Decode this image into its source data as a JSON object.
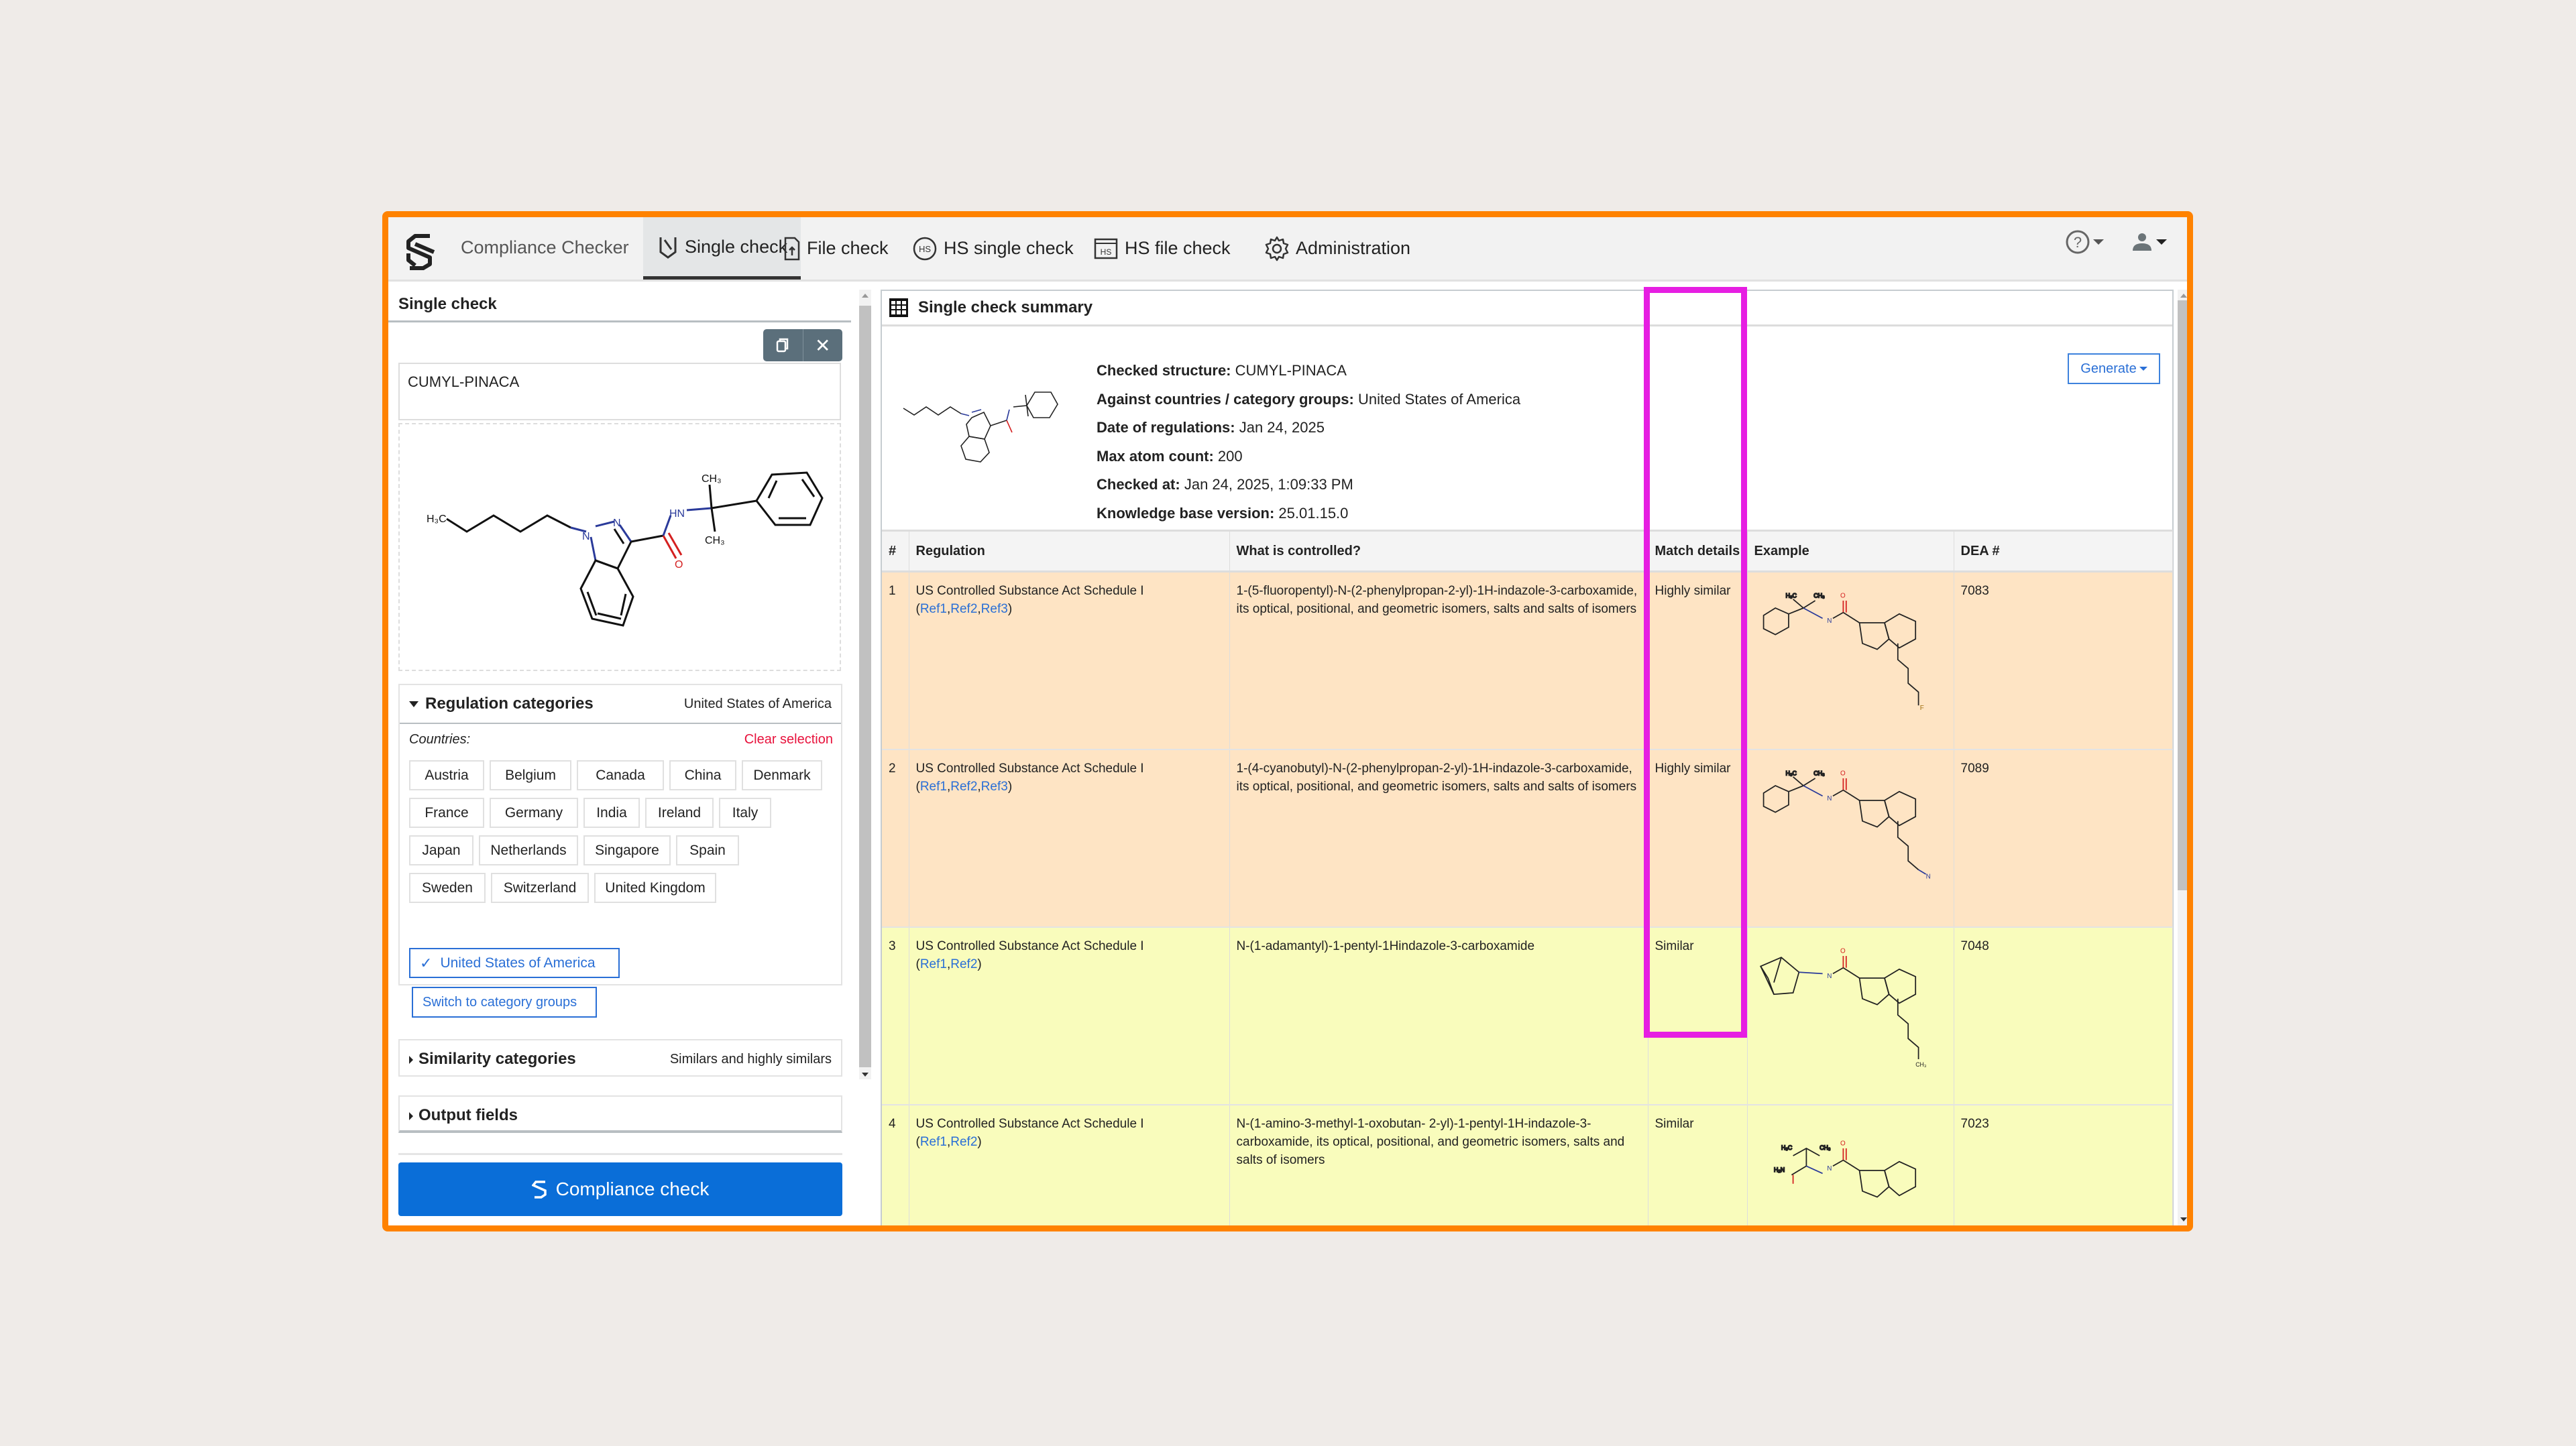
{
  "app": {
    "brand": "Compliance Checker",
    "nav": [
      {
        "label": "Single check",
        "icon": "single-check-icon",
        "active": true
      },
      {
        "label": "File check",
        "icon": "file-upload-icon",
        "active": false
      },
      {
        "label": "HS single check",
        "icon": "hs-globe-icon",
        "active": false
      },
      {
        "label": "HS file check",
        "icon": "hs-file-icon",
        "active": false
      },
      {
        "label": "Administration",
        "icon": "gear-icon",
        "active": false
      }
    ],
    "help_icon": "help-icon",
    "user_icon": "user-icon"
  },
  "left": {
    "title": "Single check",
    "copy_icon": "copy-icon",
    "clear_icon": "close-icon",
    "structure_name": "CUMYL-PINACA",
    "regulation": {
      "title": "Regulation categories",
      "value": "United States of America",
      "countries_label": "Countries:",
      "clear_selection": "Clear selection",
      "countries": [
        [
          "Austria",
          "Belgium",
          "Canada",
          "China",
          "Denmark"
        ],
        [
          "France",
          "Germany",
          "India",
          "Ireland",
          "Italy"
        ],
        [
          "Japan",
          "Netherlands",
          "Singapore",
          "Spain"
        ],
        [
          "Sweden",
          "Switzerland",
          "United Kingdom"
        ]
      ],
      "selected_country": "United States of America",
      "switch_button": "Switch to category groups"
    },
    "similarity": {
      "title": "Similarity categories",
      "value": "Similars and highly similars"
    },
    "output_fields": {
      "title": "Output fields"
    },
    "compliance_button": "Compliance check"
  },
  "summary": {
    "title": "Single check summary",
    "generate_button": "Generate",
    "fields": [
      {
        "label": "Checked structure:",
        "value": "CUMYL-PINACA"
      },
      {
        "label": "Against countries / category groups:",
        "value": "United States of America"
      },
      {
        "label": "Date of regulations:",
        "value": "Jan 24, 2025"
      },
      {
        "label": "Max atom count:",
        "value": "200"
      },
      {
        "label": "Checked at:",
        "value": "Jan 24, 2025, 1:09:33 PM"
      },
      {
        "label": "Knowledge base version:",
        "value": "25.01.15.0"
      }
    ]
  },
  "table": {
    "headers": [
      "#",
      "Regulation",
      "What is controlled?",
      "Match details",
      "Example",
      "DEA #"
    ],
    "rows": [
      {
        "num": "1",
        "regulation": "US Controlled Substance Act Schedule I",
        "refs": [
          "Ref1",
          "Ref2",
          "Ref3"
        ],
        "controlled": "1-(5-fluoropentyl)-N-(2-phenylpropan-2-yl)-1H-indazole-3-carboxamide, its optical, positional, and geometric isomers, salts and salts of isomers",
        "match": "Highly similar",
        "dea": "7083",
        "color": "#fee4c4"
      },
      {
        "num": "2",
        "regulation": "US Controlled Substance Act Schedule I",
        "refs": [
          "Ref1",
          "Ref2",
          "Ref3"
        ],
        "controlled": "1-(4-cyanobutyl)-N-(2-phenylpropan-2-yl)-1H-indazole-3-carboxamide, its optical, positional, and geometric isomers, salts and salts of isomers",
        "match": "Highly similar",
        "dea": "7089",
        "color": "#fee4c4"
      },
      {
        "num": "3",
        "regulation": "US Controlled Substance Act Schedule I",
        "refs": [
          "Ref1",
          "Ref2"
        ],
        "controlled": "N-(1-adamantyl)-1-pentyl-1Hindazole-3-carboxamide",
        "match": "Similar",
        "dea": "7048",
        "color": "#f9fcbc"
      },
      {
        "num": "4",
        "regulation": "US Controlled Substance Act Schedule I",
        "refs": [
          "Ref1",
          "Ref2"
        ],
        "controlled": "N-(1-amino-3-methyl-1-oxobutan- 2-yl)-1-pentyl-1H-indazole-3-carboxamide, its optical, positional, and geometric isomers, salts and salts of isomers",
        "match": "Similar",
        "dea": "7023",
        "color": "#f9fcbc"
      }
    ]
  },
  "colors": {
    "frame": "#ff8200",
    "highlight": "#e61ee2",
    "accent": "#0a6ed8",
    "highly_similar": "#fee4c4",
    "similar": "#f9fcbc"
  }
}
